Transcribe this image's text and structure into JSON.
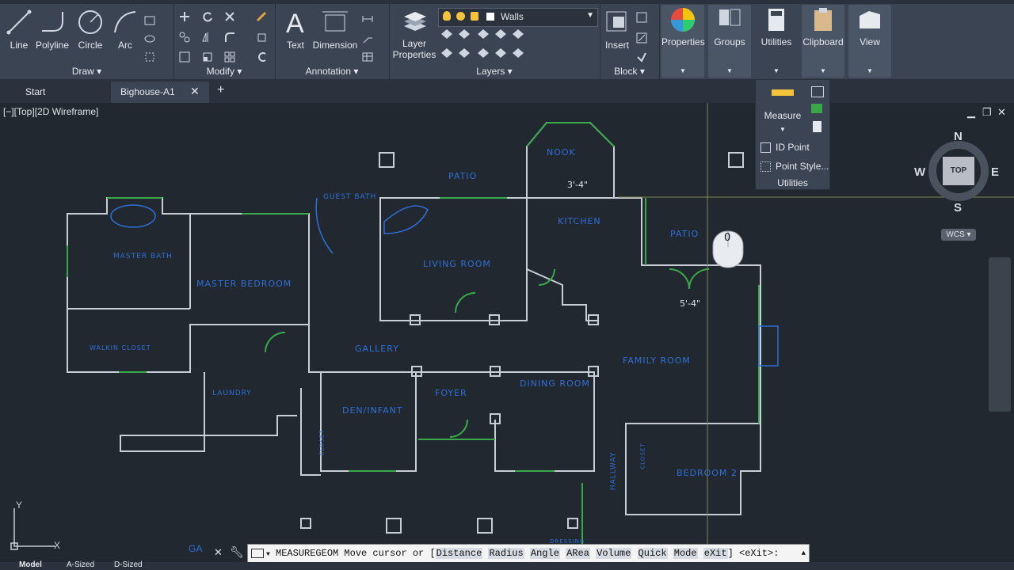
{
  "ribbon": {
    "draw": {
      "label": "Draw",
      "tools": {
        "line": "Line",
        "polyline": "Polyline",
        "circle": "Circle",
        "arc": "Arc"
      }
    },
    "modify": {
      "label": "Modify"
    },
    "annotation": {
      "label": "Annotation",
      "tools": {
        "text": "Text",
        "dimension": "Dimension"
      }
    },
    "layers": {
      "label": "Layers",
      "current_layer": "Walls",
      "layer_properties": "Layer\nProperties"
    },
    "block": {
      "label": "Block",
      "insert": "Insert"
    },
    "properties": "Properties",
    "groups": "Groups",
    "utilities": "Utilities",
    "clipboard": "Clipboard",
    "view": "View"
  },
  "utilities_dropdown": {
    "measure": "Measure",
    "id_point": "ID Point",
    "point_style": "Point Style...",
    "title": "Utilities"
  },
  "tabs": [
    {
      "label": "Start"
    },
    {
      "label": "Bighouse-A1"
    }
  ],
  "viewport": {
    "label": "[−][Top][2D Wireframe]"
  },
  "viewcube": {
    "n": "N",
    "s": "S",
    "e": "E",
    "w": "W",
    "face": "TOP",
    "wcs": "WCS"
  },
  "drawing": {
    "rooms": {
      "patio_top": "PATIO",
      "nook": "NOOK",
      "guest_bath": "GUEST BATH",
      "kitchen": "KITCHEN",
      "patio_right": "PATIO",
      "master_bath": "MASTER BATH",
      "master_bedroom": "MASTER BEDROOM",
      "living_room": "LIVING ROOM",
      "walkin_closet": "WALKIN CLOSET",
      "gallery": "GALLERY",
      "family_room": "FAMILY ROOM",
      "laundry": "LAUNDRY",
      "foyer": "FOYER",
      "dining_room": "DINING ROOM",
      "den_infant": "DEN/INFANT",
      "hallway": "HALLWAY",
      "bedroom2": "BEDROOM 2",
      "closet": "CLOSET",
      "closet2": "CLOSET",
      "dressing": "DRESSING"
    },
    "dims": {
      "d1": "3'-4\"",
      "d2": "5'-4\""
    },
    "cursor_readout": "0"
  },
  "ucs": {
    "y": "Y",
    "x": "X"
  },
  "command": {
    "prefix": "MEASUREGEOM Move cursor or [",
    "options": [
      "Distance",
      "Radius",
      "Angle",
      "ARea",
      "Volume",
      "Quick",
      "Mode",
      "eXit"
    ],
    "suffix": "] <eXit>:",
    "left_hint": "GA"
  },
  "status": {
    "model": "Model",
    "layout1": "A-Sized",
    "layout2": "D-Sized"
  },
  "colors": {
    "ribbon": "#3b4453",
    "canvas": "#212830",
    "wall": "#c9ced6",
    "door": "#3aa84a",
    "text": "#2f6fd6"
  }
}
